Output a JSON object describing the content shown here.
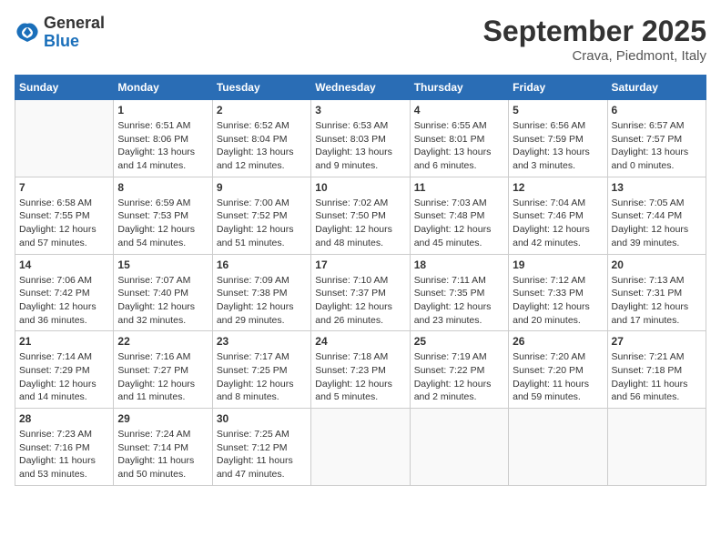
{
  "logo": {
    "general": "General",
    "blue": "Blue"
  },
  "header": {
    "title": "September 2025",
    "location": "Crava, Piedmont, Italy"
  },
  "weekdays": [
    "Sunday",
    "Monday",
    "Tuesday",
    "Wednesday",
    "Thursday",
    "Friday",
    "Saturday"
  ],
  "weeks": [
    [
      {
        "day": "",
        "info": ""
      },
      {
        "day": "1",
        "info": "Sunrise: 6:51 AM\nSunset: 8:06 PM\nDaylight: 13 hours\nand 14 minutes."
      },
      {
        "day": "2",
        "info": "Sunrise: 6:52 AM\nSunset: 8:04 PM\nDaylight: 13 hours\nand 12 minutes."
      },
      {
        "day": "3",
        "info": "Sunrise: 6:53 AM\nSunset: 8:03 PM\nDaylight: 13 hours\nand 9 minutes."
      },
      {
        "day": "4",
        "info": "Sunrise: 6:55 AM\nSunset: 8:01 PM\nDaylight: 13 hours\nand 6 minutes."
      },
      {
        "day": "5",
        "info": "Sunrise: 6:56 AM\nSunset: 7:59 PM\nDaylight: 13 hours\nand 3 minutes."
      },
      {
        "day": "6",
        "info": "Sunrise: 6:57 AM\nSunset: 7:57 PM\nDaylight: 13 hours\nand 0 minutes."
      }
    ],
    [
      {
        "day": "7",
        "info": "Sunrise: 6:58 AM\nSunset: 7:55 PM\nDaylight: 12 hours\nand 57 minutes."
      },
      {
        "day": "8",
        "info": "Sunrise: 6:59 AM\nSunset: 7:53 PM\nDaylight: 12 hours\nand 54 minutes."
      },
      {
        "day": "9",
        "info": "Sunrise: 7:00 AM\nSunset: 7:52 PM\nDaylight: 12 hours\nand 51 minutes."
      },
      {
        "day": "10",
        "info": "Sunrise: 7:02 AM\nSunset: 7:50 PM\nDaylight: 12 hours\nand 48 minutes."
      },
      {
        "day": "11",
        "info": "Sunrise: 7:03 AM\nSunset: 7:48 PM\nDaylight: 12 hours\nand 45 minutes."
      },
      {
        "day": "12",
        "info": "Sunrise: 7:04 AM\nSunset: 7:46 PM\nDaylight: 12 hours\nand 42 minutes."
      },
      {
        "day": "13",
        "info": "Sunrise: 7:05 AM\nSunset: 7:44 PM\nDaylight: 12 hours\nand 39 minutes."
      }
    ],
    [
      {
        "day": "14",
        "info": "Sunrise: 7:06 AM\nSunset: 7:42 PM\nDaylight: 12 hours\nand 36 minutes."
      },
      {
        "day": "15",
        "info": "Sunrise: 7:07 AM\nSunset: 7:40 PM\nDaylight: 12 hours\nand 32 minutes."
      },
      {
        "day": "16",
        "info": "Sunrise: 7:09 AM\nSunset: 7:38 PM\nDaylight: 12 hours\nand 29 minutes."
      },
      {
        "day": "17",
        "info": "Sunrise: 7:10 AM\nSunset: 7:37 PM\nDaylight: 12 hours\nand 26 minutes."
      },
      {
        "day": "18",
        "info": "Sunrise: 7:11 AM\nSunset: 7:35 PM\nDaylight: 12 hours\nand 23 minutes."
      },
      {
        "day": "19",
        "info": "Sunrise: 7:12 AM\nSunset: 7:33 PM\nDaylight: 12 hours\nand 20 minutes."
      },
      {
        "day": "20",
        "info": "Sunrise: 7:13 AM\nSunset: 7:31 PM\nDaylight: 12 hours\nand 17 minutes."
      }
    ],
    [
      {
        "day": "21",
        "info": "Sunrise: 7:14 AM\nSunset: 7:29 PM\nDaylight: 12 hours\nand 14 minutes."
      },
      {
        "day": "22",
        "info": "Sunrise: 7:16 AM\nSunset: 7:27 PM\nDaylight: 12 hours\nand 11 minutes."
      },
      {
        "day": "23",
        "info": "Sunrise: 7:17 AM\nSunset: 7:25 PM\nDaylight: 12 hours\nand 8 minutes."
      },
      {
        "day": "24",
        "info": "Sunrise: 7:18 AM\nSunset: 7:23 PM\nDaylight: 12 hours\nand 5 minutes."
      },
      {
        "day": "25",
        "info": "Sunrise: 7:19 AM\nSunset: 7:22 PM\nDaylight: 12 hours\nand 2 minutes."
      },
      {
        "day": "26",
        "info": "Sunrise: 7:20 AM\nSunset: 7:20 PM\nDaylight: 11 hours\nand 59 minutes."
      },
      {
        "day": "27",
        "info": "Sunrise: 7:21 AM\nSunset: 7:18 PM\nDaylight: 11 hours\nand 56 minutes."
      }
    ],
    [
      {
        "day": "28",
        "info": "Sunrise: 7:23 AM\nSunset: 7:16 PM\nDaylight: 11 hours\nand 53 minutes."
      },
      {
        "day": "29",
        "info": "Sunrise: 7:24 AM\nSunset: 7:14 PM\nDaylight: 11 hours\nand 50 minutes."
      },
      {
        "day": "30",
        "info": "Sunrise: 7:25 AM\nSunset: 7:12 PM\nDaylight: 11 hours\nand 47 minutes."
      },
      {
        "day": "",
        "info": ""
      },
      {
        "day": "",
        "info": ""
      },
      {
        "day": "",
        "info": ""
      },
      {
        "day": "",
        "info": ""
      }
    ]
  ]
}
